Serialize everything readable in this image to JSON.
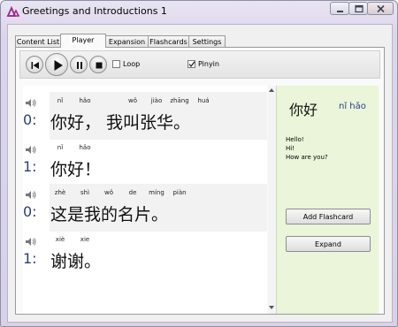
{
  "window": {
    "title": "Greetings and Introductions 1",
    "icons": [
      "app-icon",
      "minimize-icon",
      "maximize-icon",
      "close-icon"
    ]
  },
  "tabs": [
    {
      "label": "Content List",
      "active": false
    },
    {
      "label": "Player",
      "active": true
    },
    {
      "label": "Expansion",
      "active": false
    },
    {
      "label": "Flashcards",
      "active": false
    },
    {
      "label": "Settings",
      "active": false
    }
  ],
  "toolbar": {
    "buttons": [
      "rewind-icon",
      "play-icon",
      "pause-icon",
      "stop-icon"
    ],
    "loop_label": "Loop",
    "loop_checked": false,
    "pinyin_label": "Pinyin",
    "pinyin_checked": true
  },
  "sentences": [
    {
      "speaker": "0:",
      "highlighted": true,
      "pinyin": [
        "nǐ",
        "hǎo",
        "wǒ",
        "jiào",
        "zhāng",
        "huá"
      ],
      "hanzi": "你好， 我叫张华。"
    },
    {
      "speaker": "1:",
      "highlighted": false,
      "pinyin": [
        "nǐ",
        "hǎo"
      ],
      "hanzi": "你好！"
    },
    {
      "speaker": "0:",
      "highlighted": true,
      "pinyin": [
        "zhè",
        "shì",
        "wǒ",
        "de",
        "míng",
        "piàn"
      ],
      "hanzi": "这是我的名片。"
    },
    {
      "speaker": "1:",
      "highlighted": false,
      "pinyin": [
        "xiè",
        "xie"
      ],
      "hanzi": "谢谢。"
    }
  ],
  "detail": {
    "hanzi": "你好",
    "pinyin": "nǐ hǎo",
    "translations": [
      "Hello!",
      "Hi!",
      "How are you?"
    ],
    "add_flashcard_label": "Add Flashcard",
    "expand_label": "Expand"
  },
  "colors": {
    "detail_background": "#eaf5d9",
    "speaker_number": "#2c3e74",
    "pinyin_detail": "#2c3e90",
    "title_accent": "#a0288c"
  }
}
